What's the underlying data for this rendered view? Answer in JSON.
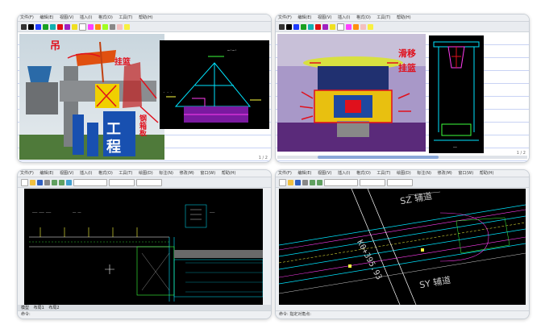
{
  "panels": {
    "tl": {
      "menu": [
        "文件(F)",
        "编辑(E)",
        "视图(V)",
        "插入(I)",
        "格式(O)",
        "工具(T)",
        "帮助(H)"
      ],
      "annotations": [
        "吊",
        "挂篮",
        "钢箱板"
      ],
      "photo_text": [
        "工",
        "程"
      ],
      "page": "1 / 2"
    },
    "tr": {
      "menu": [
        "文件(F)",
        "编辑(E)",
        "视图(V)",
        "插入(I)",
        "格式(O)",
        "工具(T)",
        "帮助(H)"
      ],
      "annotations": [
        "滑移",
        "挂篮"
      ],
      "page": "1 / 2"
    },
    "bl": {
      "menu": [
        "文件(F)",
        "编辑(E)",
        "视图(V)",
        "插入(I)",
        "格式(O)",
        "工具(T)",
        "绘图(D)",
        "标注(N)",
        "修改(M)",
        "窗口(W)",
        "帮助(H)"
      ],
      "tabs": [
        "模型",
        "布局1",
        "布局2"
      ],
      "status": "命令:"
    },
    "br": {
      "menu": [
        "文件(F)",
        "编辑(E)",
        "视图(V)",
        "插入(I)",
        "格式(O)",
        "工具(T)",
        "绘图(D)",
        "标注(N)",
        "修改(M)",
        "窗口(W)",
        "帮助(H)"
      ],
      "labels": [
        "SZ 辅道",
        "SY 辅道",
        "K0+395.93"
      ],
      "status": "命令: 指定对角点:"
    }
  },
  "colors": {
    "annotation": "#e0101c",
    "cad_bg": "#000000",
    "cad_cyan": "#00e5ff",
    "cad_magenta": "#ff3cf0",
    "cad_yellow": "#ffff40",
    "cad_green": "#3cff3c"
  }
}
